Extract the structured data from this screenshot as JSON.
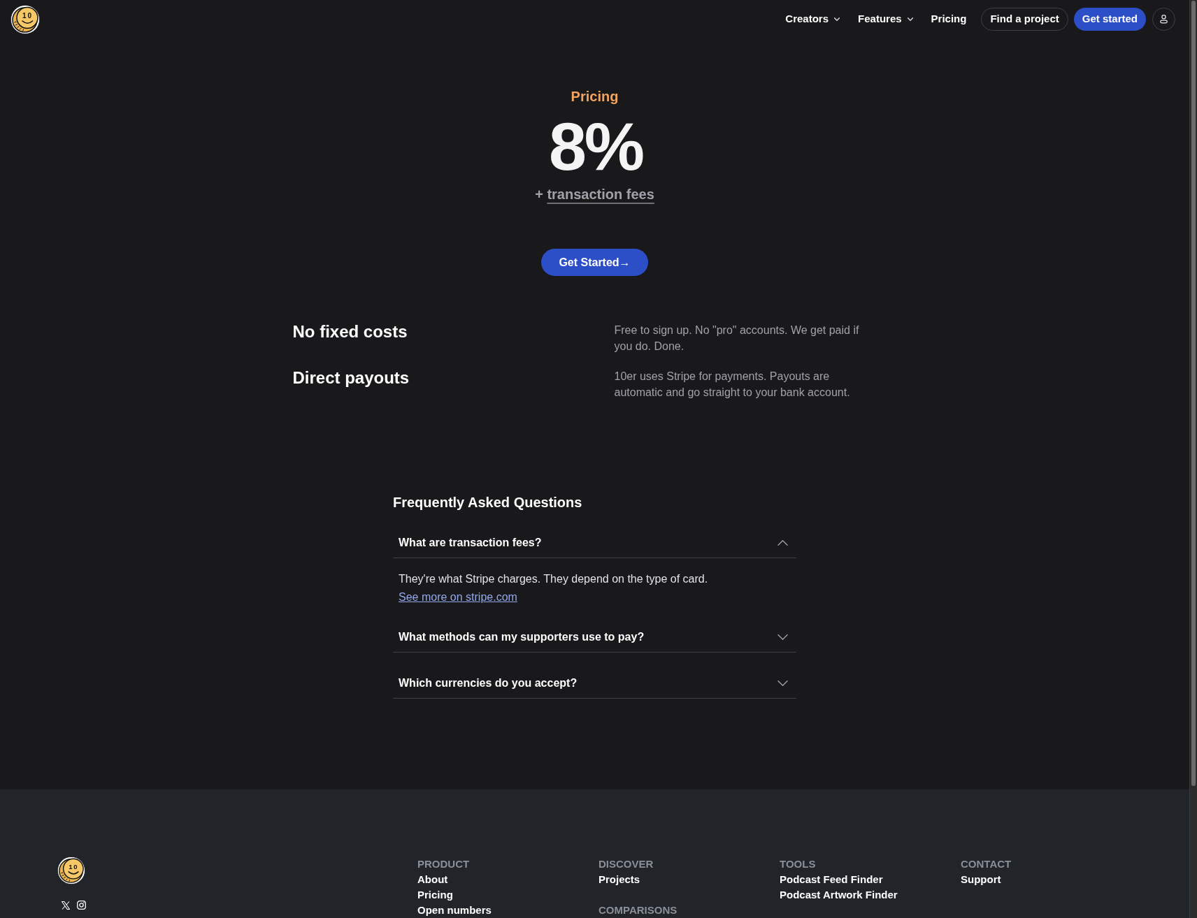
{
  "nav": {
    "logo_text": "10",
    "items": [
      {
        "label": "Creators",
        "kind": "menu"
      },
      {
        "label": "Features",
        "kind": "menu"
      },
      {
        "label": "Pricing",
        "kind": "link"
      },
      {
        "label": "Find a project",
        "kind": "outline"
      },
      {
        "label": "Get started",
        "kind": "primary"
      }
    ]
  },
  "hero": {
    "eyebrow": "Pricing",
    "rate": "8%",
    "fee_prefix": "+",
    "fee_link": "transaction fees",
    "cta": "Get Started→"
  },
  "features": [
    {
      "title": "No fixed costs",
      "text": "Free to sign up. No \"pro\" accounts. We get paid if you do. Done."
    },
    {
      "title": "Direct payouts",
      "text": "10er uses Stripe for payments. Payouts are automatic and go straight to your bank account."
    }
  ],
  "faq": {
    "title": "Frequently Asked Questions",
    "items": [
      {
        "question": "What are transaction fees?",
        "expanded": true,
        "answer": "They're what Stripe charges. They depend on the type of card.",
        "link": "See more on stripe.com"
      },
      {
        "question": "What methods can my supporters use to pay?",
        "expanded": false
      },
      {
        "question": "Which currencies do you accept?",
        "expanded": false
      }
    ]
  },
  "footer": {
    "logo_text": "10",
    "columns": [
      {
        "sections": [
          {
            "heading": "PRODUCT",
            "links": [
              "About",
              "Pricing",
              "Open numbers"
            ]
          }
        ]
      },
      {
        "sections": [
          {
            "heading": "DISCOVER",
            "links": [
              "Projects"
            ]
          },
          {
            "heading": "COMPARISONS"
          }
        ]
      },
      {
        "sections": [
          {
            "heading": "TOOLS",
            "links": [
              "Podcast Feed Finder",
              "Podcast Artwork Finder"
            ]
          }
        ]
      },
      {
        "sections": [
          {
            "heading": "CONTACT",
            "links": [
              "Support"
            ]
          }
        ]
      }
    ]
  }
}
